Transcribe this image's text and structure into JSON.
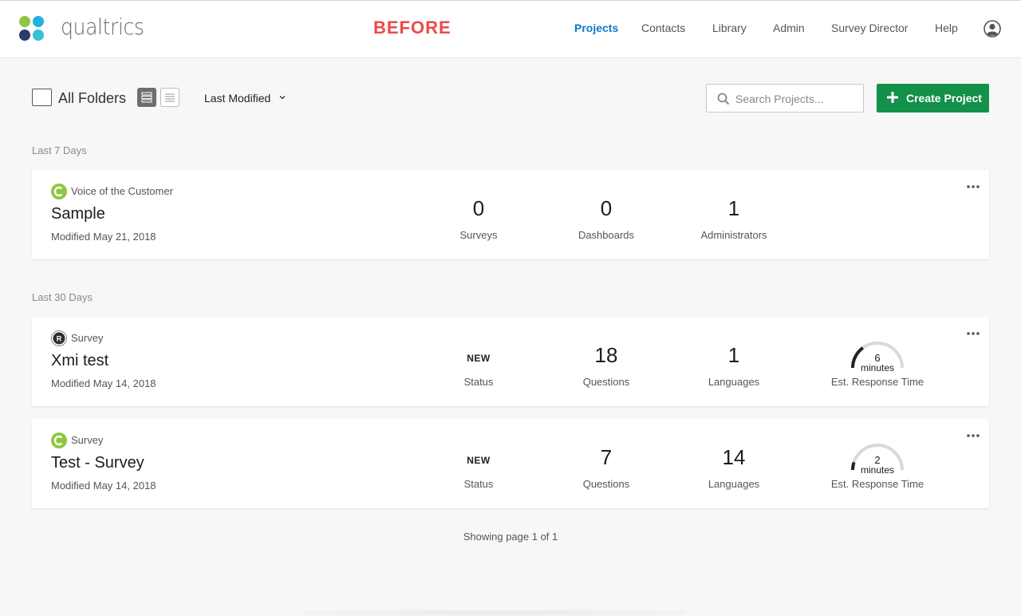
{
  "brand": {
    "name": "qualtrics",
    "mark": ".",
    "logo_colors": [
      "#8dc63f",
      "#21b3dc",
      "#2d3b6b",
      "#33c2d7"
    ]
  },
  "annotation": "BEFORE",
  "nav": {
    "items": [
      "Projects",
      "Contacts",
      "Library",
      "Admin",
      "Survey Director",
      "Help"
    ],
    "active": "Projects"
  },
  "toolbar": {
    "folder_label": "All Folders",
    "sort_label": "Last Modified",
    "search_placeholder": "Search Projects...",
    "create_label": "Create Project"
  },
  "sections": [
    {
      "label": "Last 7 Days",
      "projects": [
        {
          "type": "Voice of the Customer",
          "type_icon": "voc-icon",
          "name": "Sample",
          "modified": "Modified May 21, 2018",
          "stats": [
            {
              "value": "0",
              "label": "Surveys"
            },
            {
              "value": "0",
              "label": "Dashboards"
            },
            {
              "value": "1",
              "label": "Administrators"
            }
          ]
        }
      ]
    },
    {
      "label": "Last 30 Days",
      "projects": [
        {
          "type": "Survey",
          "type_icon": "r-survey-icon",
          "name": "Xmi test",
          "modified": "Modified May 14, 2018",
          "stats": [
            {
              "value": "NEW",
              "label": "Status"
            },
            {
              "value": "18",
              "label": "Questions"
            },
            {
              "value": "1",
              "label": "Languages"
            }
          ],
          "response_time": {
            "value": "6",
            "unit": "minutes",
            "label": "Est. Response Time",
            "fill_fraction": 0.3
          }
        },
        {
          "type": "Survey",
          "type_icon": "voc-survey-icon",
          "name": "Test - Survey",
          "modified": "Modified May 14, 2018",
          "stats": [
            {
              "value": "NEW",
              "label": "Status"
            },
            {
              "value": "7",
              "label": "Questions"
            },
            {
              "value": "14",
              "label": "Languages"
            }
          ],
          "response_time": {
            "value": "2",
            "unit": "minutes",
            "label": "Est. Response Time",
            "fill_fraction": 0.1
          }
        }
      ]
    }
  ],
  "pager": "Showing page 1 of 1",
  "colors": {
    "accent": "#0b7bc1",
    "create": "#13904a",
    "before": "#ec4949",
    "voc_green": "#8dc63f"
  }
}
